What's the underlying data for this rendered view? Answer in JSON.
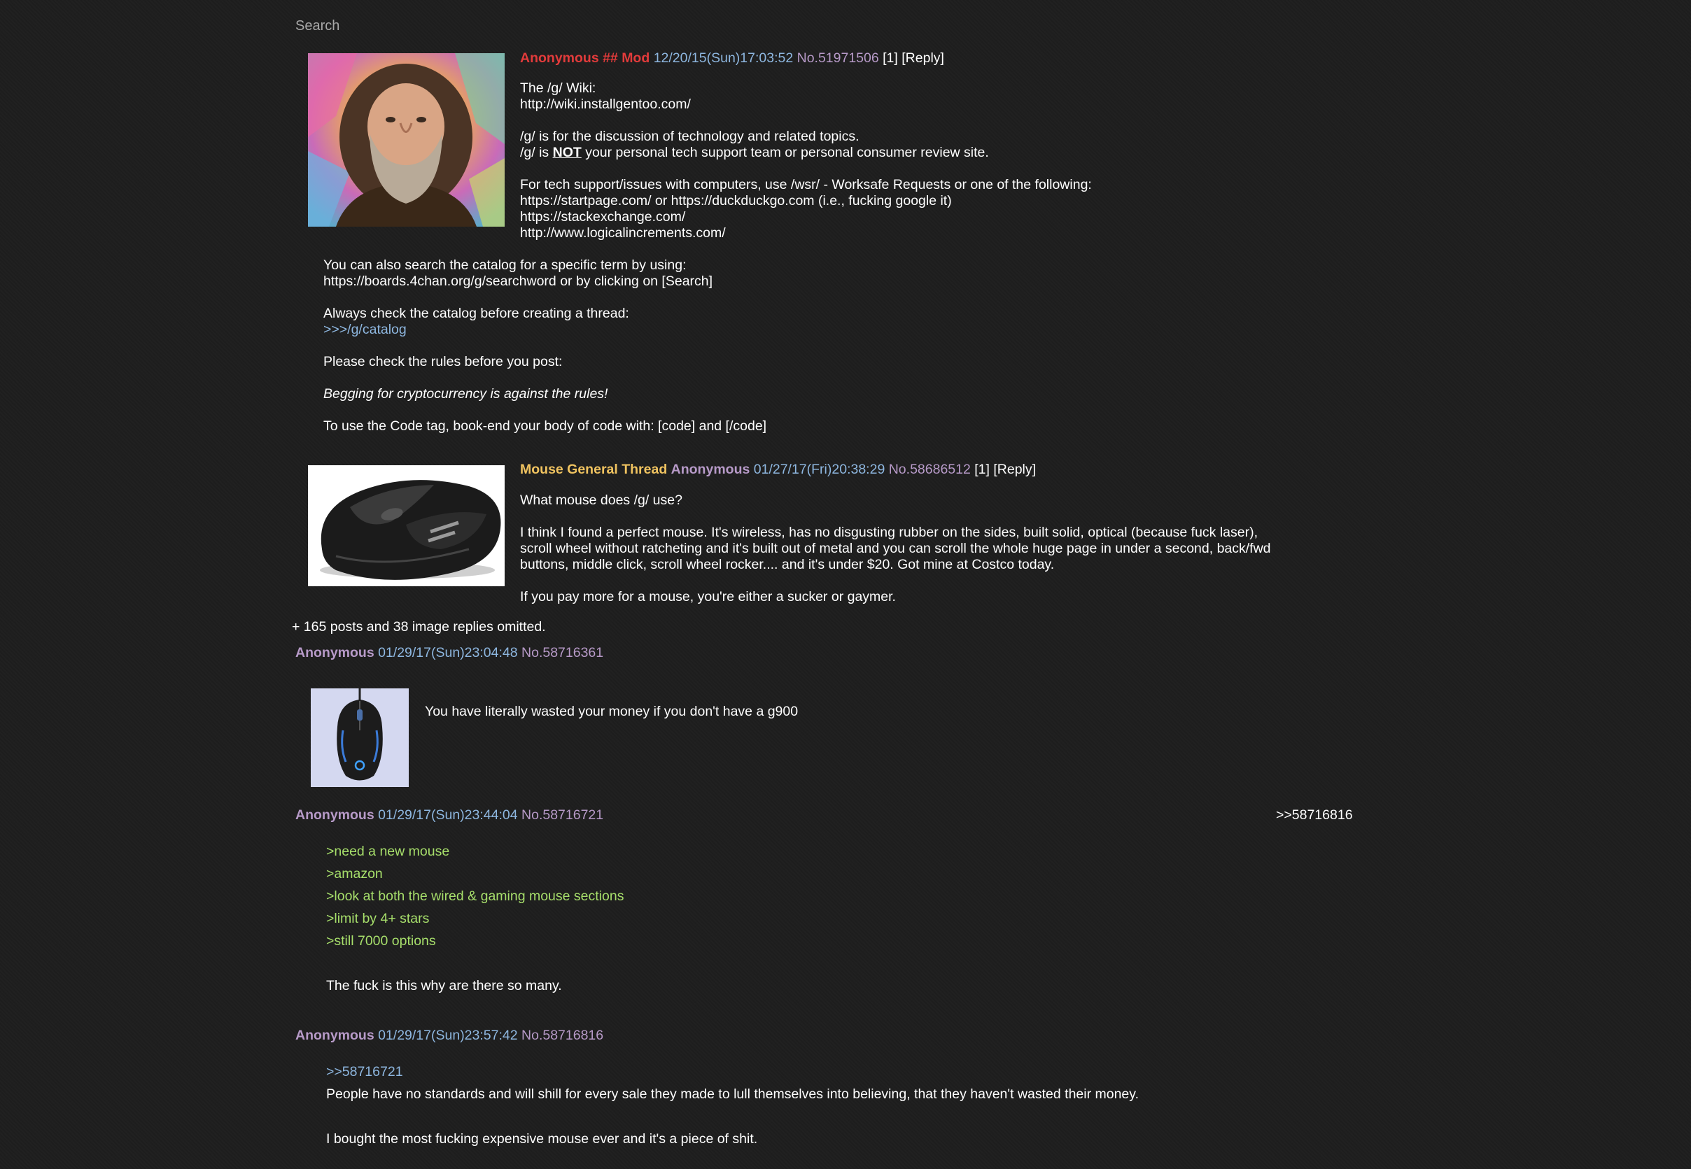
{
  "search": {
    "label": "Search"
  },
  "post1": {
    "name": "Anonymous ## Mod",
    "date": "12/20/15(Sun)17:03:52",
    "number": "No.51971506",
    "count": "[1]",
    "reply": "[Reply]",
    "lines": {
      "l1": "The /g/ Wiki:",
      "l2": "http://wiki.installgentoo.com/",
      "l3": "/g/ is for the discussion of technology and related topics.",
      "l4a": "/g/ is ",
      "l4b": "NOT",
      "l4c": " your personal tech support team or personal consumer review site.",
      "l5": "For tech support/issues with computers, use /wsr/ - Worksafe Requests or one of the following:",
      "l6": "https://startpage.com/ or https://duckduckgo.com (i.e., fucking google it)",
      "l7": "https://stackexchange.com/",
      "l8": "http://www.logicalincrements.com/",
      "l9": "You can also search the catalog for a specific term by using:",
      "l10": "https://boards.4chan.org/g/searchword or by clicking on [Search]",
      "l11": "Always check the catalog before creating a thread:",
      "l12": ">>>/g/catalog",
      "l13": "Please check the rules before you post:",
      "l14": "Begging for cryptocurrency is against the rules!",
      "l15": "To use the Code tag, book-end your body of code with: [code] and [/code]"
    }
  },
  "post2": {
    "subject": "Mouse General Thread",
    "name": "Anonymous",
    "date": "01/27/17(Fri)20:38:29",
    "number": "No.58686512",
    "count": "[1]",
    "reply": "[Reply]",
    "lines": {
      "l1": "What mouse does /g/ use?",
      "l2": "I think I found a perfect mouse. It's wireless, has no disgusting rubber on the sides, built solid, optical (because fuck laser),",
      "l3": "scroll wheel without ratcheting and it's built out of metal and you can scroll the whole huge page in under a second, back/fwd",
      "l4": "buttons, middle click, scroll wheel rocker.... and it's under $20. Got mine at Costco today.",
      "l5": "If you pay more for a mouse, you're either a sucker or gaymer."
    }
  },
  "omitted": "+ 165 posts and 38 image replies omitted.",
  "reply1": {
    "name": "Anonymous",
    "date": "01/29/17(Sun)23:04:48",
    "number": "No.58716361",
    "text": "You have literally wasted your money if you don't have a g900"
  },
  "reply2": {
    "name": "Anonymous",
    "date": "01/29/17(Sun)23:44:04",
    "number": "No.58716721",
    "backlink": ">>58716816",
    "green": [
      ">need a new mouse",
      ">amazon",
      ">look at both the wired & gaming mouse sections",
      ">limit by 4+ stars",
      ">still 7000 options"
    ],
    "text": "The fuck is this why are there so many."
  },
  "reply3": {
    "name": "Anonymous",
    "date": "01/29/17(Sun)23:57:42",
    "number": "No.58716816",
    "quotelink": ">>58716721",
    "text1": "People have no standards and will shill for every sale they made to lull themselves into believing, that they haven't wasted their money.",
    "text2": "I bought the most fucking expensive mouse ever and it's a piece of shit."
  }
}
